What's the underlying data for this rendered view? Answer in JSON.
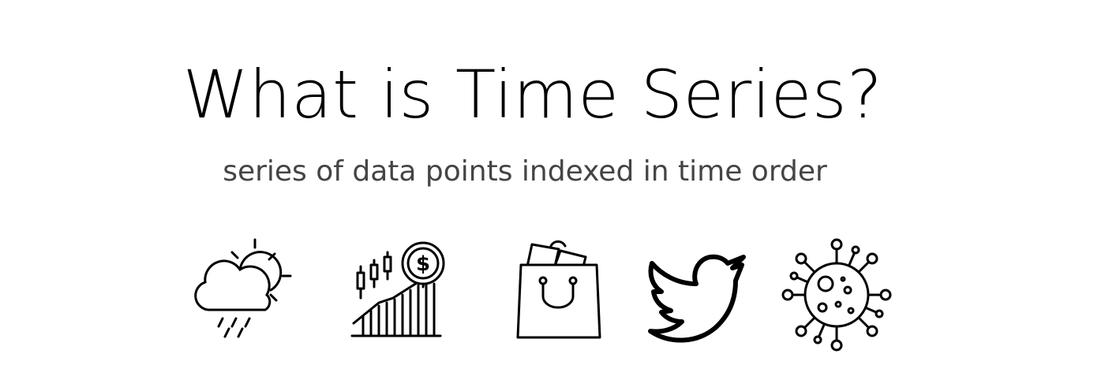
{
  "heading": {
    "title": "What is Time Series?",
    "subtitle": "series of data points indexed in time order"
  },
  "icons": [
    {
      "name": "weather-icon"
    },
    {
      "name": "stock-market-icon"
    },
    {
      "name": "shopping-bag-icon"
    },
    {
      "name": "twitter-bird-icon"
    },
    {
      "name": "virus-icon"
    }
  ],
  "finance": {
    "currency_symbol": "$"
  },
  "colors": {
    "text": "#000000",
    "subtitle": "#444444",
    "icon_stroke": "#000000",
    "background": "#ffffff"
  }
}
